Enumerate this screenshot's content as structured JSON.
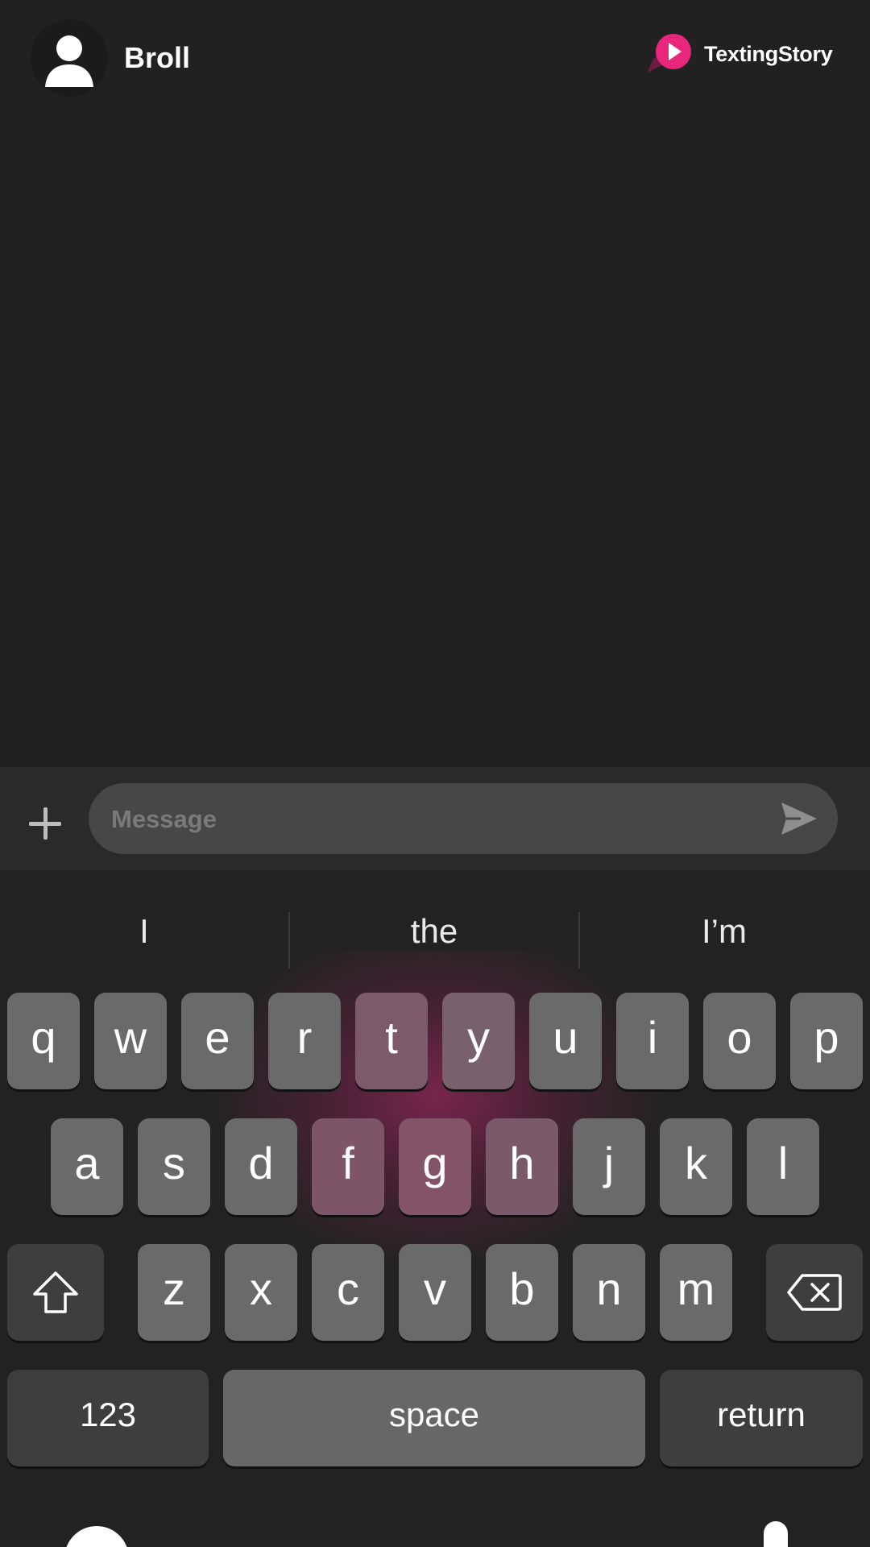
{
  "header": {
    "contact_name": "Broll",
    "brand_name": "TextingStory",
    "avatar_icon": "user-silhouette-icon",
    "logo_icon": "play-bubble-logo",
    "logo_color": "#e8267c"
  },
  "composer": {
    "placeholder": "Message",
    "add_icon": "plus-icon",
    "send_icon": "send-icon"
  },
  "keyboard": {
    "suggestions": [
      "I",
      "the",
      "I’m"
    ],
    "row1": [
      "q",
      "w",
      "e",
      "r",
      "t",
      "y",
      "u",
      "i",
      "o",
      "p"
    ],
    "row2": [
      "a",
      "s",
      "d",
      "f",
      "g",
      "h",
      "j",
      "k",
      "l"
    ],
    "row3": [
      "z",
      "x",
      "c",
      "v",
      "b",
      "n",
      "m"
    ],
    "numbers_label": "123",
    "space_label": "space",
    "return_label": "return",
    "shift_icon": "shift-icon",
    "delete_icon": "backspace-icon",
    "emoji_icon": "emoji-icon",
    "mic_icon": "microphone-icon",
    "glow_color": "#be286e"
  }
}
